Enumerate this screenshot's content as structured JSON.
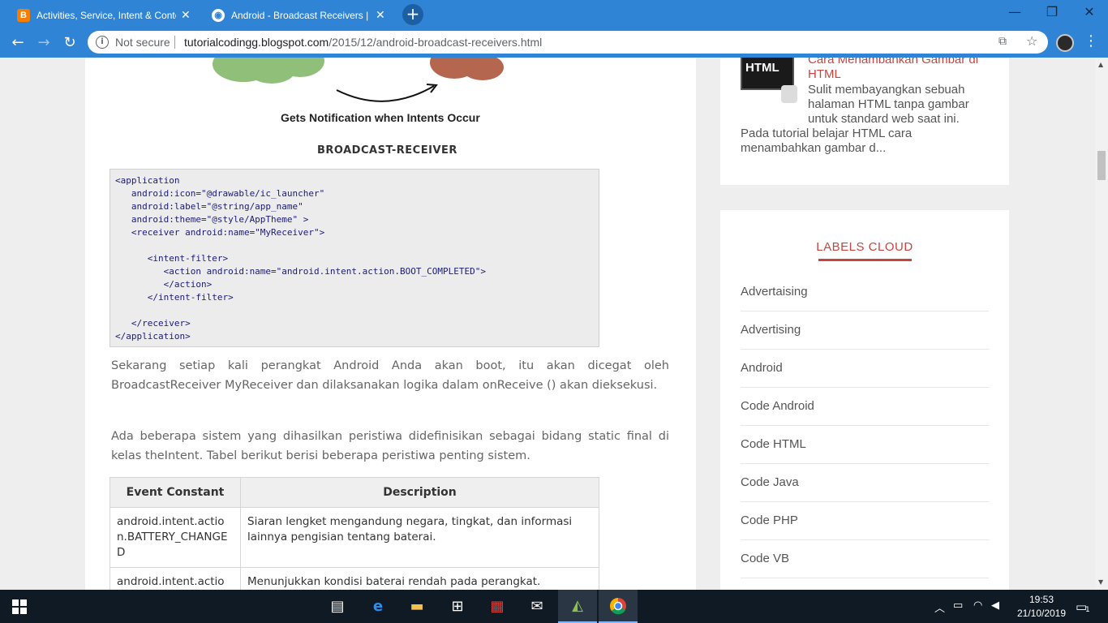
{
  "browser": {
    "tabs": [
      {
        "title": "Activities, Service, Intent & Conte",
        "favicon": "blogger-icon",
        "active": false
      },
      {
        "title": "Android - Broadcast Receivers | T",
        "favicon": "globe-icon",
        "active": true
      }
    ],
    "security_label": "Not secure",
    "url_host": "tutorialcodingg.blogspot.com",
    "url_path": "/2015/12/android-broadcast-receivers.html",
    "colors": {
      "chrome": "#2f84d6",
      "accent_red": "#c8453f"
    }
  },
  "article": {
    "image_caption": "Gets Notification when Intents Occur",
    "image_heading": "BROADCAST-RECEIVER",
    "code_lines": [
      "<application",
      "   android:icon=\"@drawable/ic_launcher\"",
      "   android:label=\"@string/app_name\"",
      "   android:theme=\"@style/AppTheme\" >",
      "   <receiver android:name=\"MyReceiver\">",
      "",
      "      <intent-filter>",
      "         <action android:name=\"android.intent.action.BOOT_COMPLETED\">",
      "         </action>",
      "      </intent-filter>",
      "",
      "   </receiver>",
      "</application>"
    ],
    "paragraph1": "Sekarang setiap kali perangkat Android Anda akan boot, itu akan dicegat oleh BroadcastReceiver MyReceiver dan dilaksanakan logika dalam onReceive () akan dieksekusi.",
    "paragraph2": "Ada beberapa sistem yang dihasilkan peristiwa didefinisikan sebagai bidang static final di kelas theIntent. Tabel berikut berisi beberapa peristiwa penting sistem.",
    "table": {
      "headers": [
        "Event Constant",
        "Description"
      ],
      "rows": [
        [
          "android.intent.action.BATTERY_CHANGED",
          "Siaran lengket mengandung negara, tingkat, dan informasi lainnya pengisian tentang baterai."
        ],
        [
          "android.intent.actio",
          "Menunjukkan kondisi baterai rendah pada perangkat."
        ]
      ]
    }
  },
  "sidebar": {
    "recent_post": {
      "thumb_text": "HTML",
      "title": "Cara Menambahkan Gambar di HTML",
      "excerpt_a": "Sulit membayangkan sebuah halaman  HTML  tanpa gambar untuk standard web saat ini.",
      "excerpt_b": "Pada tutorial belajar HTML cara menambahkan gambar d..."
    },
    "labels_title": "LABELS CLOUD",
    "labels": [
      "Advertaising",
      "Advertising",
      "Android",
      "Code Android",
      "Code HTML",
      "Code Java",
      "Code PHP",
      "Code VB"
    ]
  },
  "taskbar": {
    "time": "19:53",
    "date": "21/10/2019",
    "notification_count": "1"
  }
}
